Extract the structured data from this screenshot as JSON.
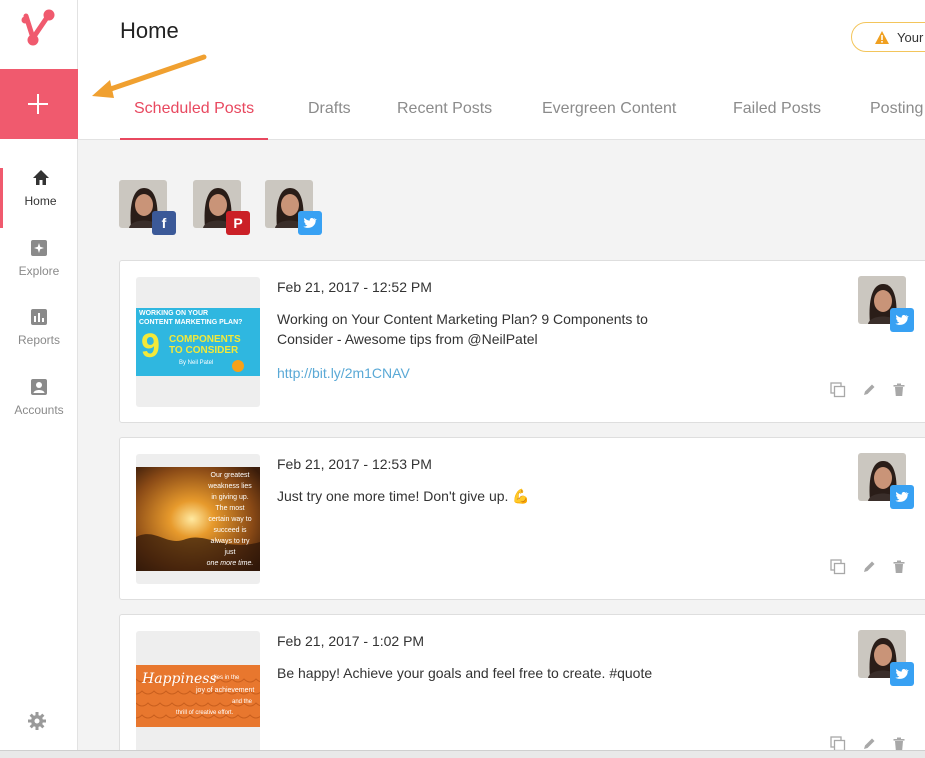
{
  "header": {
    "title": "Home",
    "warning_text": "Your"
  },
  "sidebar": {
    "items": [
      {
        "label": "Home",
        "icon": "home-icon"
      },
      {
        "label": "Explore",
        "icon": "explore-icon"
      },
      {
        "label": "Reports",
        "icon": "reports-icon"
      },
      {
        "label": "Accounts",
        "icon": "accounts-icon"
      }
    ]
  },
  "tabs": [
    {
      "label": "Scheduled Posts",
      "active": true
    },
    {
      "label": "Drafts"
    },
    {
      "label": "Recent Posts"
    },
    {
      "label": "Evergreen Content"
    },
    {
      "label": "Failed Posts"
    },
    {
      "label": "Posting"
    }
  ],
  "profiles": [
    {
      "network": "facebook",
      "glyph": "f"
    },
    {
      "network": "pinterest",
      "glyph": "P"
    },
    {
      "network": "twitter",
      "glyph": "t"
    }
  ],
  "posts": [
    {
      "date": "Feb 21, 2017 - 12:52 PM",
      "text": "Working on Your Content Marketing Plan? 9 Components to Consider - Awesome tips from @NeilPatel",
      "link": "http://bit.ly/2m1CNAV",
      "thumb": {
        "line1": "WORKING ON YOUR",
        "line2": "CONTENT MARKETING PLAN?",
        "number": "9",
        "line3": "COMPONENTS",
        "line4": "TO CONSIDER",
        "byline": "By Neil Patel"
      }
    },
    {
      "date": "Feb 21, 2017 - 12:53 PM",
      "text": "Just try one more time! Don't give up. 💪",
      "thumb": {
        "lines": [
          "Our greatest",
          "weakness lies",
          "in giving up.",
          "The most",
          "certain way to",
          "succeed is",
          "always to try",
          "just",
          "one more time."
        ]
      }
    },
    {
      "date": "Feb 21, 2017 - 1:02 PM",
      "text": "Be happy! Achieve your goals and feel free to create. #quote",
      "thumb": {
        "title": "Happiness",
        "lines": [
          "lies in the",
          "joy of achievement",
          "and the",
          "thrill of creative effort."
        ]
      }
    }
  ],
  "colors": {
    "accent": "#f05a6e",
    "facebook": "#3b5998",
    "pinterest": "#cb2027",
    "twitter": "#38a1f3",
    "link": "#5aa9d6",
    "arrow": "#f0a030"
  }
}
